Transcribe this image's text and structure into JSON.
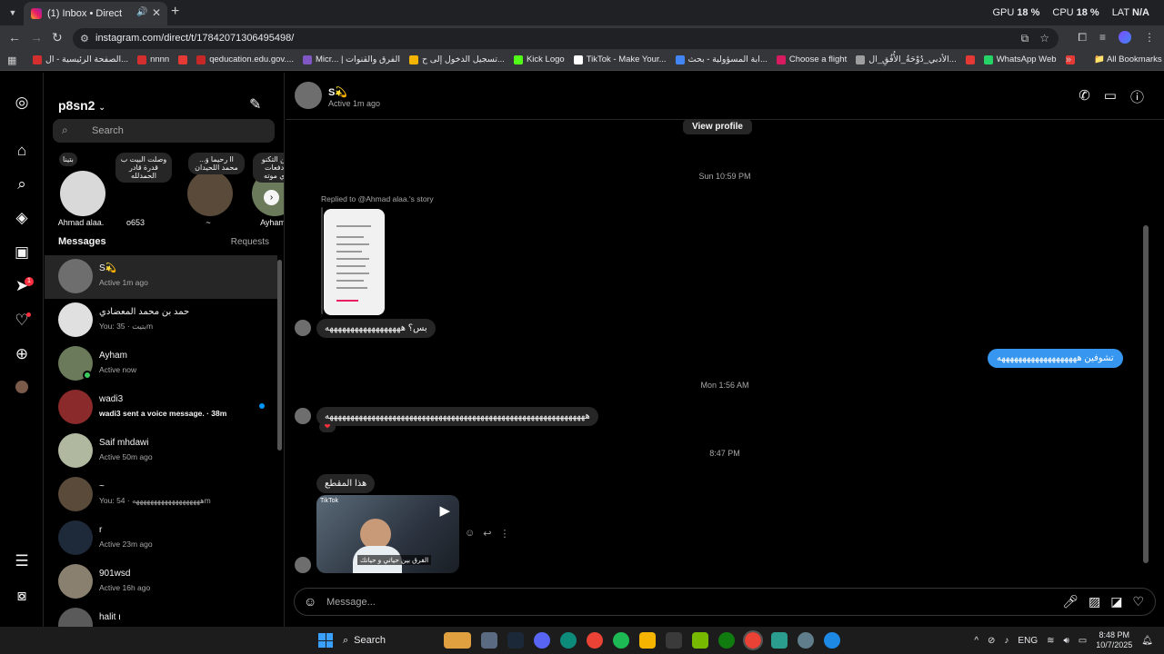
{
  "browser": {
    "tab_title": "(1) Inbox • Direct",
    "tab_new": "+",
    "url": "instagram.com/direct/t/17842071306495498/",
    "stats": [
      {
        "label": "GPU",
        "value": "18 %"
      },
      {
        "label": "CPU",
        "value": "18 %"
      },
      {
        "label": "LAT",
        "value": "N/A"
      }
    ],
    "bookmarks": [
      {
        "label": "الصفحة الرئيسية - ال...",
        "color": "#d32f2f"
      },
      {
        "label": "nnnn",
        "color": "#d32f2f"
      },
      {
        "label": "",
        "color": "#e53935"
      },
      {
        "label": "qeducation.edu.gov....",
        "color": "#c62828"
      },
      {
        "label": "Micr... | الفرق والقنوات",
        "color": "#7e57c2"
      },
      {
        "label": "تسجيل الدخول إلى ح...",
        "color": "#f4b400"
      },
      {
        "label": "Kick Logo",
        "color": "#53fc18"
      },
      {
        "label": "TikTok - Make Your...",
        "color": "#ffffff"
      },
      {
        "label": "ابة المسؤولية - بحث...",
        "color": "#4285f4"
      },
      {
        "label": "Choose a flight",
        "color": "#d81b60"
      },
      {
        "label": "الأدبي_دُوْحَةُ_الأُفُقِ_ال...",
        "color": "#9e9e9e"
      },
      {
        "label": "",
        "color": "#e53935"
      },
      {
        "label": "WhatsApp Web",
        "color": "#25d366"
      },
      {
        "label": "",
        "color": "#e53935"
      }
    ],
    "bookmarks_more": "»",
    "all_bookmarks": "All Bookmarks"
  },
  "sidebar": {
    "account": "p8sn2",
    "notifications_badge": "1"
  },
  "convo": {
    "search_placeholder": "Search",
    "messages_label": "Messages",
    "requests_label": "Requests",
    "notes": [
      {
        "bubble": "بتينا",
        "name": "Ahmad alaa.",
        "avatar": "#d9d9d9"
      },
      {
        "bubble": "وصلت البيت ب قدرة قادر الحمدلله",
        "name": "o653",
        "avatar": "#000000"
      },
      {
        "bubble": "II رحيما وَ... محمد اللحيدان",
        "name": "~",
        "avatar": "#5a4a3a"
      },
      {
        "bubble": "ض من التكنو تقوا دفعات موازي موته",
        "name": "Ayham",
        "avatar": "#6b7a5a"
      }
    ],
    "threads": [
      {
        "name": "S💫",
        "sub": "Active 1m ago",
        "avatar": "#6e6e6e",
        "active": true,
        "online": false,
        "unread": false,
        "bold": false
      },
      {
        "name": "حمد بن محمد المعضادي",
        "sub": "You: بتيت · 35m",
        "avatar": "#e0e0e0",
        "active": false,
        "online": false,
        "unread": false,
        "bold": false
      },
      {
        "name": "Ayham",
        "sub": "Active now",
        "avatar": "#6b7a5a",
        "active": false,
        "online": true,
        "unread": false,
        "bold": false
      },
      {
        "name": "wadi3",
        "sub": "wadi3 sent a voice message. · 38m",
        "avatar": "#8a2a2a",
        "active": false,
        "online": false,
        "unread": true,
        "bold": true
      },
      {
        "name": "Saif mhdawi",
        "sub": "Active 50m ago",
        "avatar": "#b0b8a0",
        "active": false,
        "online": false,
        "unread": false,
        "bold": false
      },
      {
        "name": "~",
        "sub": "You: هههههههههههههههههههه · 54m",
        "avatar": "#5a4a3a",
        "active": false,
        "online": false,
        "unread": false,
        "bold": false
      },
      {
        "name": "r",
        "sub": "Active 23m ago",
        "avatar": "#1e2a3a",
        "active": false,
        "online": false,
        "unread": false,
        "bold": false
      },
      {
        "name": "901wsd",
        "sub": "Active 16h ago",
        "avatar": "#8a8070",
        "active": false,
        "online": false,
        "unread": false,
        "bold": false
      },
      {
        "name": "halit ı",
        "sub": "",
        "avatar": "#5a5a5a",
        "active": false,
        "online": false,
        "unread": false,
        "bold": false
      }
    ]
  },
  "chat": {
    "name": "S💫",
    "status": "Active 1m ago",
    "view_profile": "View profile",
    "time_1": "Sun 10:59 PM",
    "replied_to": "Replied to @Ahmad alaa.'s story",
    "msg_1": "بس؟ ههههههههههههههههههه",
    "msg_out": "تشوفين هههههههههههههههههههه",
    "time_2": "Mon 1:56 AM",
    "msg_2": "ههههههههههههههههههههههههههههههههههههههههههههههههههههههههههههههه",
    "reaction": "❤",
    "time_3": "8:47 PM",
    "msg_3": "هذا المقطع",
    "video_caption": "الفرق بين حياتي و حياتك",
    "video_source": "TikTok",
    "composer_placeholder": "Message..."
  },
  "taskbar": {
    "search_label": "Search",
    "lang": "ENG",
    "time": "8:48 PM",
    "date": "10/7/2025"
  }
}
